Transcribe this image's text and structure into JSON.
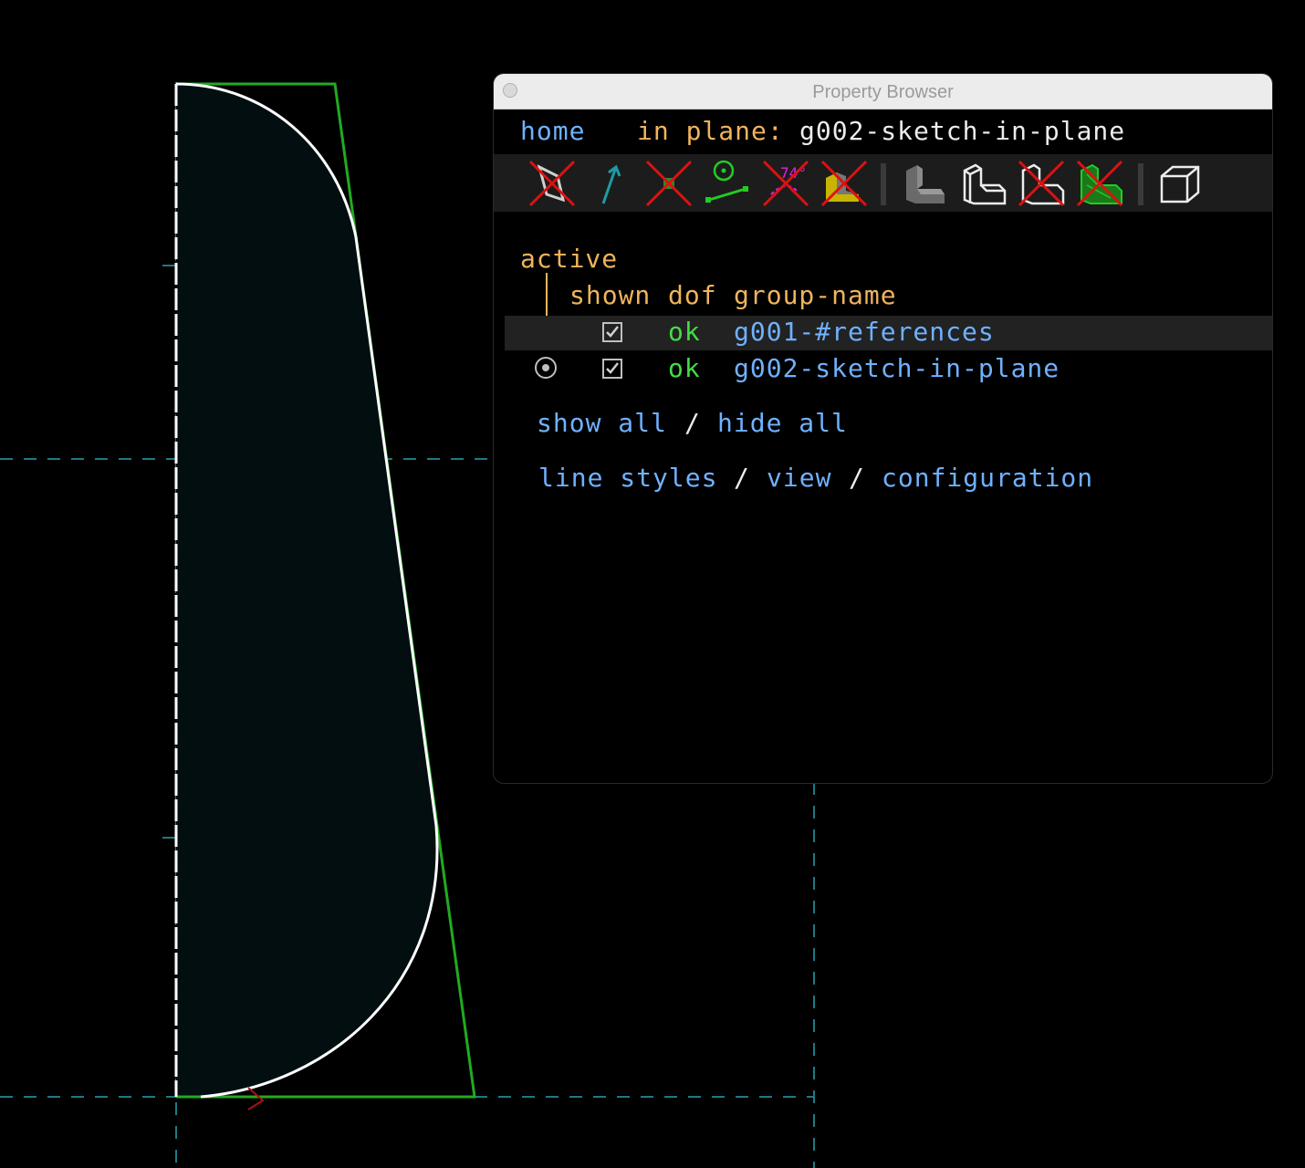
{
  "window": {
    "title": "Property Browser"
  },
  "nav": {
    "home": "home",
    "in_plane_label": "in plane:",
    "in_plane_value": "g002-sketch-in-plane"
  },
  "toolbar": {
    "icons": [
      "workplane-hidden-icon",
      "normal-arrow-icon",
      "point-hidden-icon",
      "constraints-icon",
      "dimension-hidden-icon",
      "construction-hidden-icon",
      "solid-shaded-icon",
      "solid-edges-icon",
      "outline-hidden-icon",
      "mesh-hidden-icon",
      "perspective-cube-icon"
    ]
  },
  "groups": {
    "active_label": "active",
    "headers": {
      "shown": "shown",
      "dof": "dof",
      "name": "group-name"
    },
    "rows": [
      {
        "shown": true,
        "dof": "ok",
        "name": "g001-#references",
        "active": false
      },
      {
        "shown": true,
        "dof": "ok",
        "name": "g002-sketch-in-plane",
        "active": true
      }
    ]
  },
  "actions": {
    "show_all": "show all",
    "sep1": "/",
    "hide_all": "hide all",
    "line_styles": "line styles",
    "sep2": "/",
    "view": "view",
    "sep3": "/",
    "configuration": "configuration"
  },
  "colors": {
    "link": "#6fb1ff",
    "label": "#f0b45c",
    "ok": "#44dd44",
    "construction": "#22aa22",
    "sketch": "#ffffff",
    "axis": "#1e7a82",
    "fill": "#020e10"
  }
}
